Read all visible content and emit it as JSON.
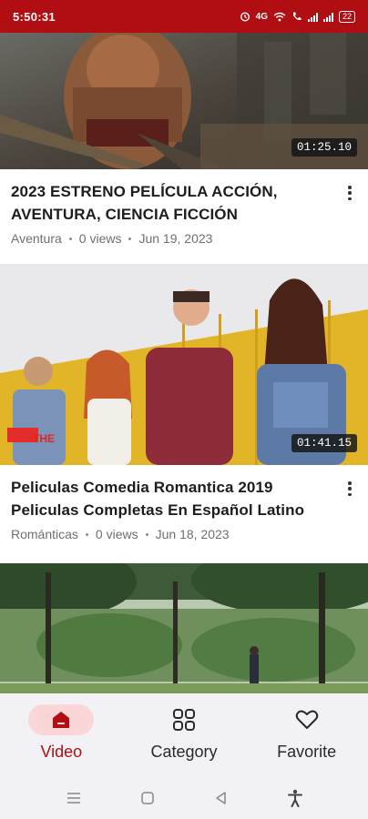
{
  "status": {
    "time": "5:50:31",
    "network": "4G",
    "battery": "22"
  },
  "videos": [
    {
      "title": "2023 ESTRENO PELÍCULA ACCIÓN, AVENTURA, CIENCIA FICCIÓN",
      "category": "Aventura",
      "views": "0 views",
      "date": "Jun 19, 2023",
      "duration": "01:25.10"
    },
    {
      "title": "Peliculas Comedia Romantica 2019 Peliculas Completas En Español Latino",
      "category": "Románticas",
      "views": "0 views",
      "date": "Jun 18, 2023",
      "duration": "01:41.15"
    }
  ],
  "nav": {
    "video": "Video",
    "category": "Category",
    "favorite": "Favorite",
    "active": "video"
  },
  "colors": {
    "brand": "#b00e12",
    "active_pill": "#fad6d6"
  },
  "icons": {
    "video": "home-icon",
    "category": "grid-icon",
    "favorite": "heart-icon"
  }
}
